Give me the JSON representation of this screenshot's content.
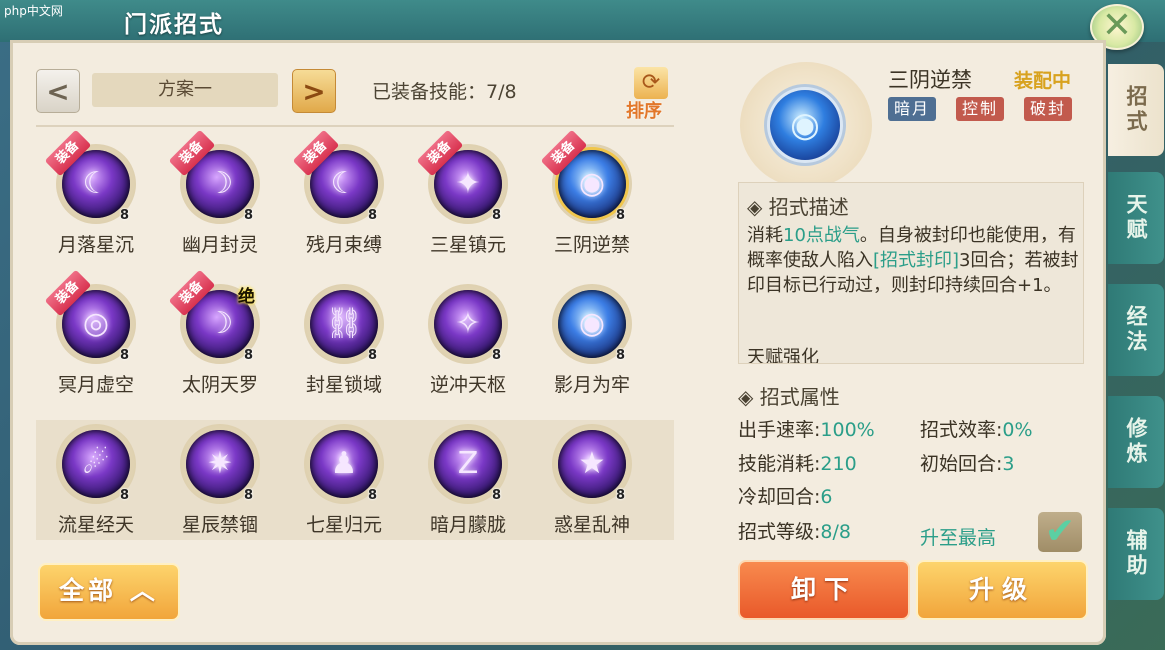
{
  "window": {
    "title": "门派招式",
    "logo": "php中文网"
  },
  "toolbar": {
    "prev": "<",
    "next": ">",
    "plan": "方案一",
    "equipped": "已装备技能：7/8",
    "sort": "排序"
  },
  "skills": [
    {
      "name": "月落星沉",
      "level": "8",
      "badge": "装备",
      "glyph": "☾"
    },
    {
      "name": "幽月封灵",
      "level": "8",
      "badge": "装备",
      "glyph": "☽"
    },
    {
      "name": "残月束缚",
      "level": "8",
      "badge": "装备",
      "glyph": "☾"
    },
    {
      "name": "三星镇元",
      "level": "8",
      "badge": "装备",
      "glyph": "✦"
    },
    {
      "name": "三阴逆禁",
      "level": "8",
      "badge": "装备",
      "glyph": "◉"
    },
    {
      "name": "冥月虚空",
      "level": "8",
      "badge": "装备",
      "glyph": "◎"
    },
    {
      "name": "太阴天罗",
      "level": "8",
      "badge": "装备",
      "extra": "绝",
      "glyph": "☽"
    },
    {
      "name": "封星锁域",
      "level": "8",
      "glyph": "⛓"
    },
    {
      "name": "逆冲天枢",
      "level": "8",
      "glyph": "✧"
    },
    {
      "name": "影月为牢",
      "level": "8",
      "glyph": "◉"
    },
    {
      "name": "流星经天",
      "level": "8",
      "glyph": "☄"
    },
    {
      "name": "星辰禁锢",
      "level": "8",
      "glyph": "✷"
    },
    {
      "name": "七星归元",
      "level": "8",
      "glyph": "♟"
    },
    {
      "name": "暗月朦胧",
      "level": "8",
      "glyph": "Z"
    },
    {
      "name": "惑星乱神",
      "level": "8",
      "glyph": "★"
    }
  ],
  "all_button": "全部 ︿",
  "detail": {
    "name": "三阴逆禁",
    "status": "装配中",
    "tags": [
      "暗月",
      "控制",
      "破封"
    ],
    "desc_title": "◈ 招式描述",
    "desc_p1": "消耗",
    "desc_hl1": "10点战气",
    "desc_p2": "。自身被封印也能使用，有概率使敌人陷入",
    "desc_hl2": "[招式封印]",
    "desc_p3": "3回合；若被封印目标已行动过，则封印持续回合+1。",
    "desc_cut": "天赋强化",
    "attr_title": "◈ 招式属性",
    "attrs": {
      "speed_label": "出手速率:",
      "speed": "100%",
      "eff_label": "招式效率:",
      "eff": "0%",
      "cost_label": "技能消耗:",
      "cost": "210",
      "init_label": "初始回合:",
      "init": "3",
      "cd_label": "冷却回合:",
      "cd": "6",
      "lvl_label": "招式等级:",
      "lvl": "8/8"
    },
    "max_label": "升至最高",
    "check": "✔",
    "unload": "卸下",
    "upgrade": "升级"
  },
  "tabs": [
    "招式",
    "天赋",
    "经法",
    "修炼",
    "辅助"
  ]
}
